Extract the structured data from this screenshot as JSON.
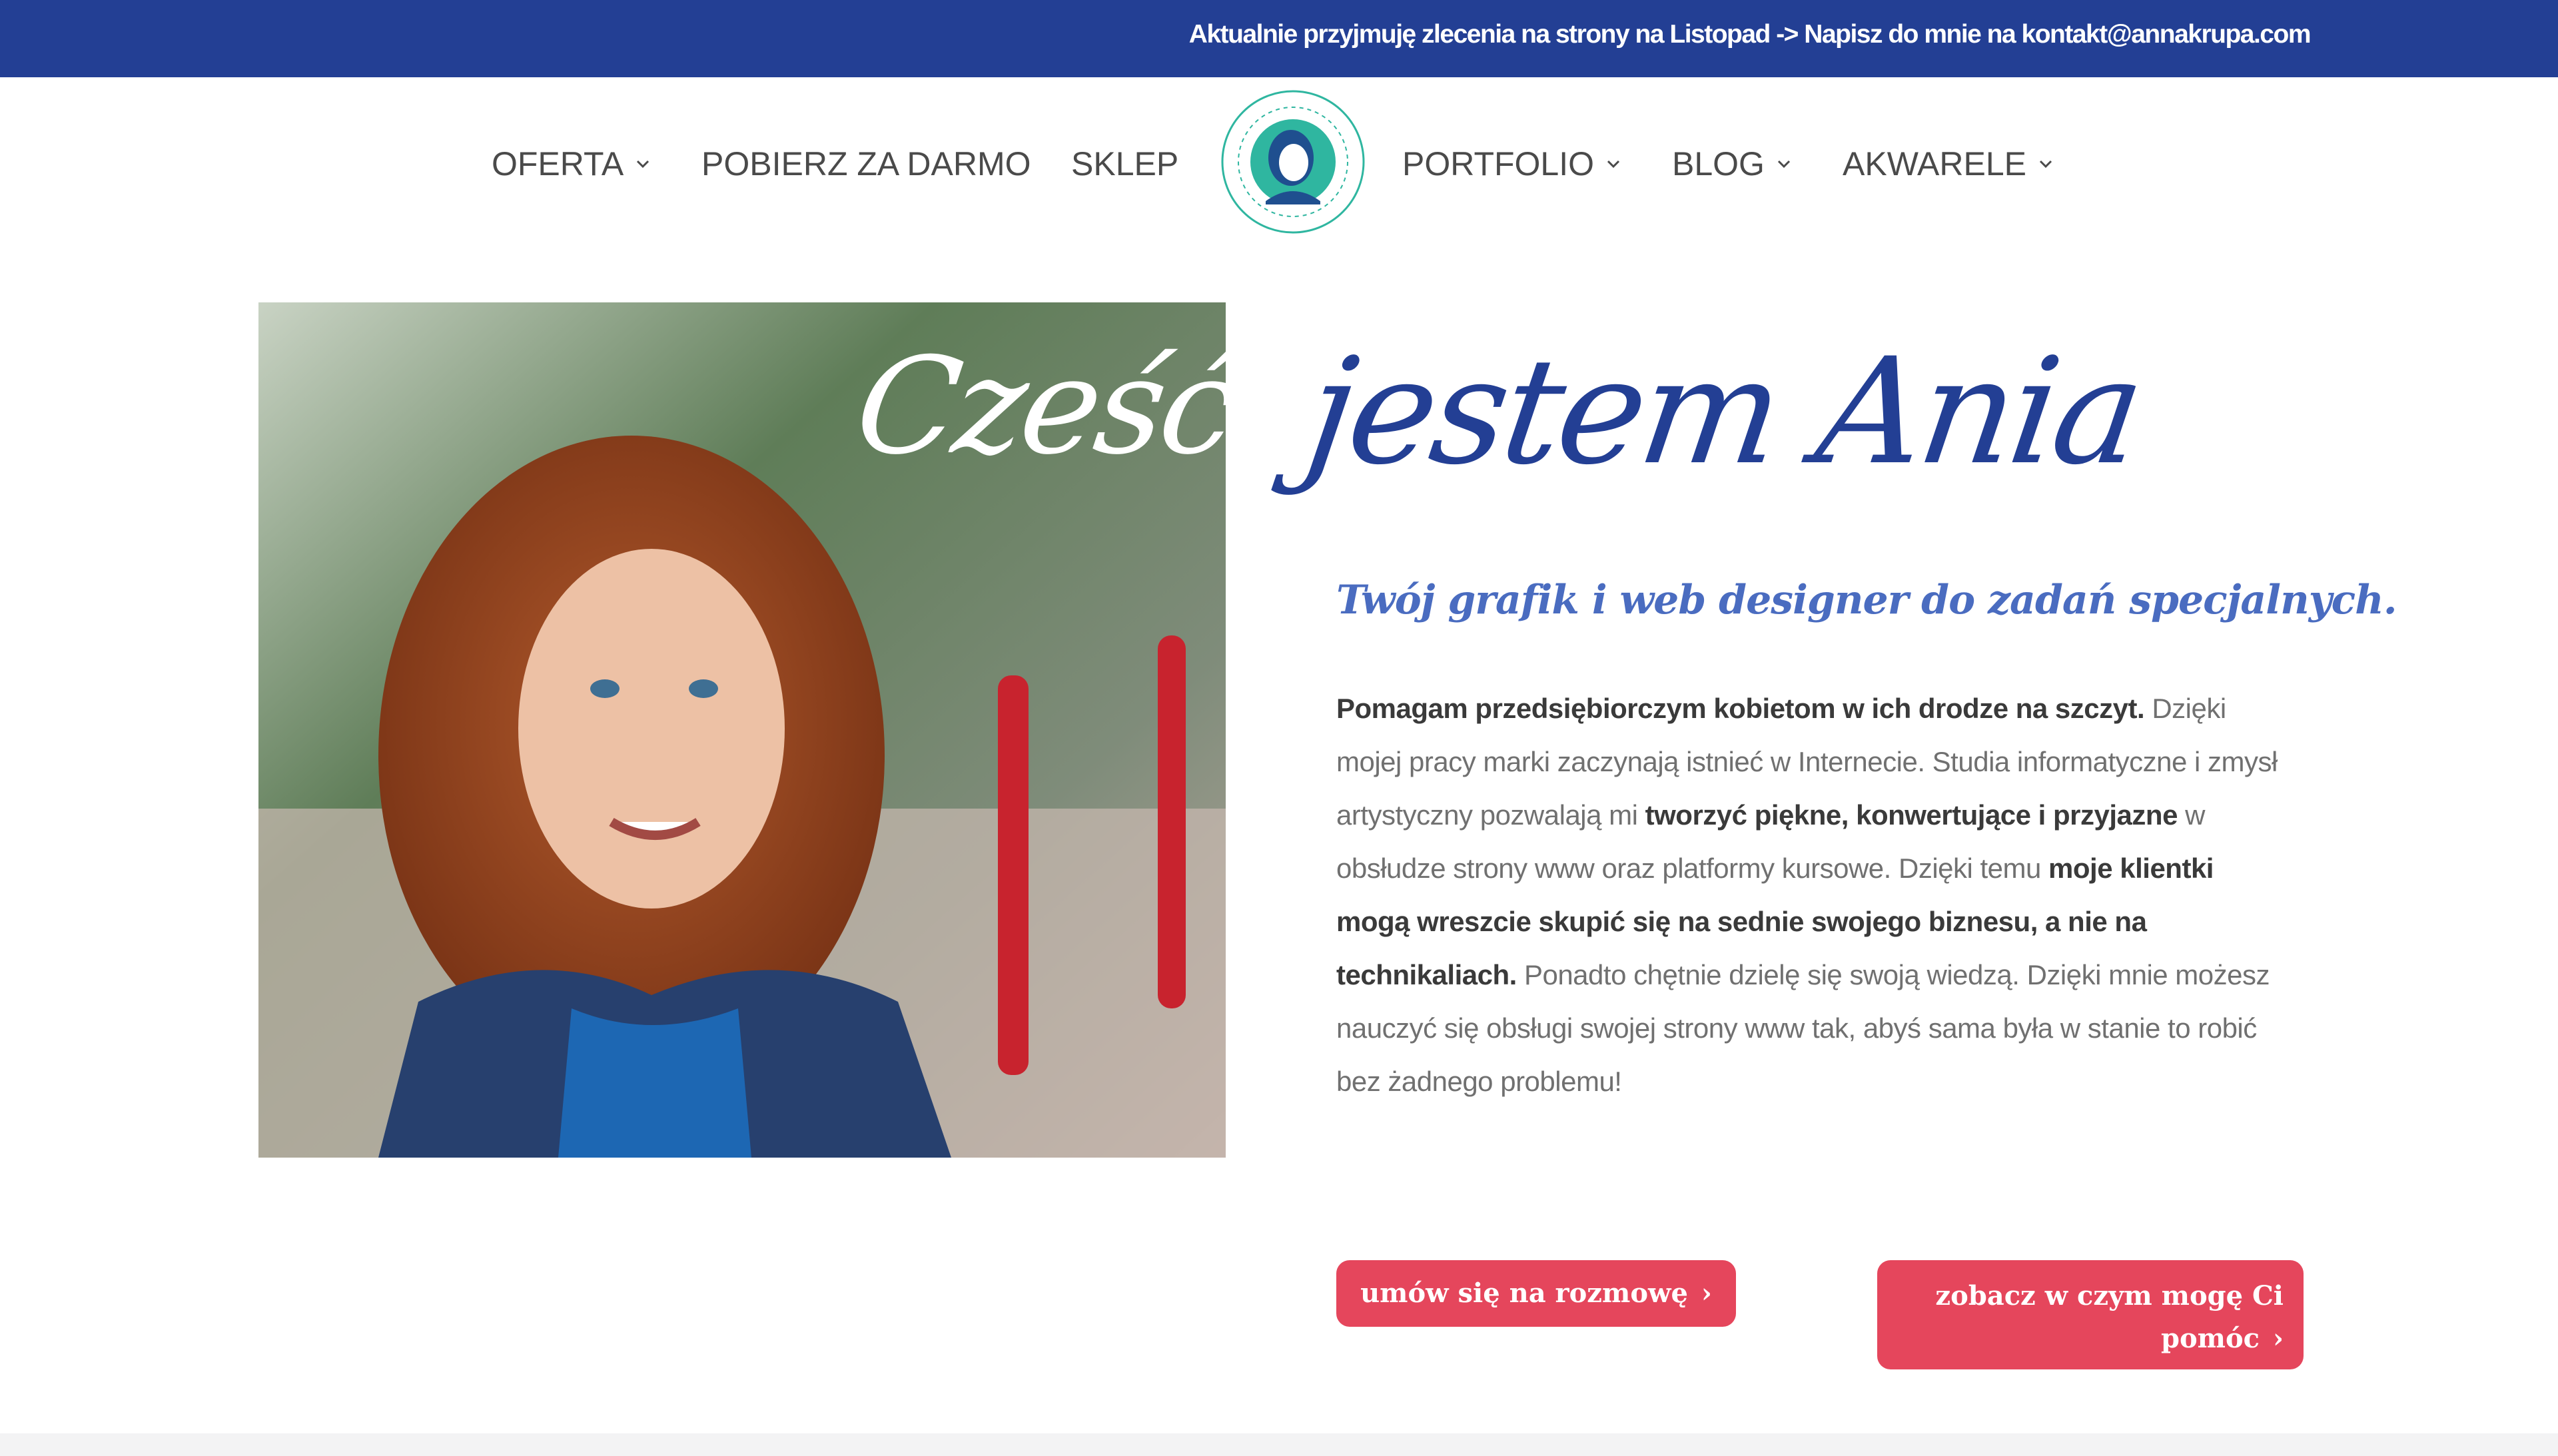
{
  "announcement": "Aktualnie przyjmuję zlecenia na strony na Listopad -> Napisz do mnie na kontakt@annakrupa.com",
  "nav": {
    "left": [
      {
        "label": "OFERTA",
        "has_dropdown": true
      },
      {
        "label": "POBIERZ ZA DARMO",
        "has_dropdown": false
      },
      {
        "label": "SKLEP",
        "has_dropdown": false
      }
    ],
    "right": [
      {
        "label": "PORTFOLIO",
        "has_dropdown": true
      },
      {
        "label": "BLOG",
        "has_dropdown": true
      },
      {
        "label": "AKWARELE",
        "has_dropdown": true
      }
    ]
  },
  "hero": {
    "photo_overlay_script": "Cześć,",
    "greeting": "jestem Ania",
    "subtitle": "Twój grafik i web designer do zadań specjalnych.",
    "paragraph": [
      {
        "text": "Pomagam przedsiębiorczym kobietom w ich drodze na szczyt.",
        "bold": true
      },
      {
        "text": " Dzięki mojej pracy marki zaczynają istnieć w Internecie. Studia informatyczne i zmysł artystyczny pozwalają mi ",
        "bold": false
      },
      {
        "text": "tworzyć piękne, konwertujące i przyjazne",
        "bold": true
      },
      {
        "text": " w obsłudze strony www oraz platformy kursowe. Dzięki temu ",
        "bold": false
      },
      {
        "text": "moje klientki mogą wreszcie skupić się na sednie swojego biznesu, a nie na technikaliach.",
        "bold": true
      },
      {
        "text": " Ponadto chętnie dzielę się swoją wiedzą. Dzięki mnie możesz nauczyć się obsługi swojej strony www tak, abyś sama była w stanie to robić bez żadnego problemu!",
        "bold": false
      }
    ],
    "buttons": {
      "primary": "umów się na rozmowę",
      "secondary_line1": "zobacz w czym mogę Ci",
      "secondary_line2": "pomóc"
    }
  },
  "colors": {
    "brand_blue": "#233f94",
    "accent_red": "#e5465c",
    "logo_teal": "#2fb6a0"
  }
}
